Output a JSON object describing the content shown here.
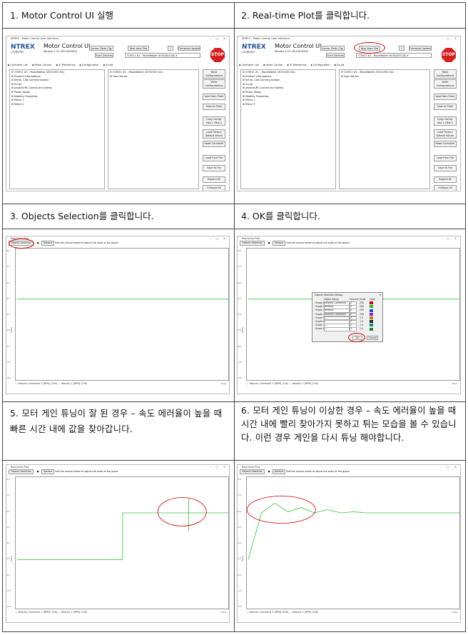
{
  "cells": [
    {
      "caption": "1. Motor Control UI 실행"
    },
    {
      "caption": "2. Real-time Plot를 클릭합니다."
    },
    {
      "caption": "3. Objects Selection를 클릭합니다."
    },
    {
      "caption": "4. OK를 클릭합니다."
    },
    {
      "caption": "5. 모터 게인 튜닝이 잘 된 경우 – 속도 에러율이 높을 때 빠른 시간 내에 값을 찾아갑니다."
    },
    {
      "caption": "6. 모터 게인 튜닝이 이상한 경우 – 속도 에러율이 높을 때 시간 내에 빨리 찾아가지 못하고 튀는 모습을 볼 수 있습니다. 이런 경우 게인을 다시 튜닝 해야합니다."
    }
  ],
  "mc_ui": {
    "window_title": "NTREX - Motor Control User Interface",
    "logo": "NTREX",
    "logo_sub": "(주)엔티렉스",
    "app_name": "Motor Control UI",
    "version": "Version 1.12 (2014/03/05)",
    "comm_ports": "Comm. Ports Cfg.",
    "scan_devices": "Scan Devices",
    "realtime_plot": "Real-time Plot",
    "help": "?",
    "firmware_update": "Firmware Update",
    "port_select": "COM11 #1 - MoonWalker DC50(30V,5A)",
    "emergency": "STOP",
    "tabs": [
      "Controller List",
      "Motor Control",
      "IO Monitoring",
      "Configuration",
      "Script"
    ],
    "tree": [
      "COM11 #1 - MoonWalker DC50(30V,5A)",
      "Product Informations",
      "Serial, CAN Communication",
      "Script",
      "Joystick/RC Control and Safety",
      "Power Stage",
      "Mobility Properties",
      "Motor 1",
      "Motor 2"
    ],
    "tree2": [
      "COM11 #1 - MoonWalker DC50(30V,5A)",
      "User Values"
    ],
    "buttons": [
      "Read Configurations",
      "Write Configurations",
      "Load from Flash",
      "Save to Flash",
      "Copy Config. Mot.1→Mot.2",
      "Load Factory Default Values",
      "Reset Controller",
      "Load from File",
      "Save to File",
      "Expand All",
      "Collapse All"
    ]
  },
  "plot_ui": {
    "window_title": "Real-time Plot",
    "objects_selection": "Objects Selection",
    "options": "Options",
    "hint": "Roll the mouse wheel to adjust the scale of the graph",
    "yticks": [
      "9.0",
      "7.5",
      "6.0",
      "4.5",
      "3.0",
      "1.5",
      "0.0",
      "-1.5",
      "-3.0"
    ],
    "ylabel": "Value",
    "xlabel": "Time",
    "legend": "— Velocity Command 1 [RPM] (250)   — Velocity 1 [RPM] (250)"
  },
  "dialog": {
    "title": "Objects Selection Dialog",
    "headers": [
      "Object Name",
      "Channel",
      "Scale",
      "Color"
    ],
    "rows": [
      {
        "graph": "Graph 1",
        "name": "Velocity Command",
        "ch": "1",
        "scale": "250",
        "color": "#d40000"
      },
      {
        "graph": "Graph 2",
        "name": "Velocity",
        "ch": "1",
        "scale": "250",
        "color": "#2fb82f"
      },
      {
        "graph": "Graph 3",
        "name": "Velocity",
        "ch": "2",
        "scale": "250",
        "color": "#1f4fd1"
      },
      {
        "graph": "Graph 4",
        "name": "Velocity Command",
        "ch": "2",
        "scale": "250",
        "color": "#9b1fbf"
      },
      {
        "graph": "Graph 5",
        "name": "—",
        "ch": "1",
        "scale": "1.0",
        "color": "#b08030"
      },
      {
        "graph": "Graph 6",
        "name": "—",
        "ch": "1",
        "scale": "1.0",
        "color": "#222222"
      },
      {
        "graph": "Graph 7",
        "name": "—",
        "ch": "1",
        "scale": "1.0",
        "color": "#0a8a8a"
      },
      {
        "graph": "Graph 8",
        "name": "—",
        "ch": "1",
        "scale": "1.0",
        "color": "#2a7a2a"
      }
    ],
    "ok": "OK",
    "cancel": "Cancel"
  },
  "chart_data": [
    {
      "type": "line",
      "series": [
        {
          "name": "Velocity 1",
          "values": [
            4.5,
            4.5
          ]
        }
      ],
      "ylim": [
        -3.0,
        9.0
      ]
    },
    {
      "type": "line",
      "series": [
        {
          "name": "Velocity 1",
          "values": [
            4.5,
            4.5
          ]
        }
      ],
      "ylim": [
        -3.0,
        9.0
      ]
    },
    {
      "type": "line",
      "series": [
        {
          "name": "Velocity 1",
          "values": [
            1.5,
            1.5,
            1.5,
            1.5,
            1.5,
            1.5,
            1.5,
            1.5,
            5.9,
            5.9,
            5.9,
            5.9,
            5.9,
            5.9,
            5.9,
            5.9,
            5.9
          ]
        }
      ],
      "ylim": [
        -3.0,
        9.0
      ]
    },
    {
      "type": "line",
      "series": [
        {
          "name": "Velocity 1",
          "values": [
            1.5,
            5.9,
            6.8,
            6.0,
            6.4,
            5.9,
            6.2,
            5.9,
            6.0,
            5.9,
            5.9,
            5.9,
            5.9,
            5.9,
            5.9,
            5.9,
            5.9
          ]
        }
      ],
      "ylim": [
        -3.0,
        9.0
      ]
    }
  ]
}
